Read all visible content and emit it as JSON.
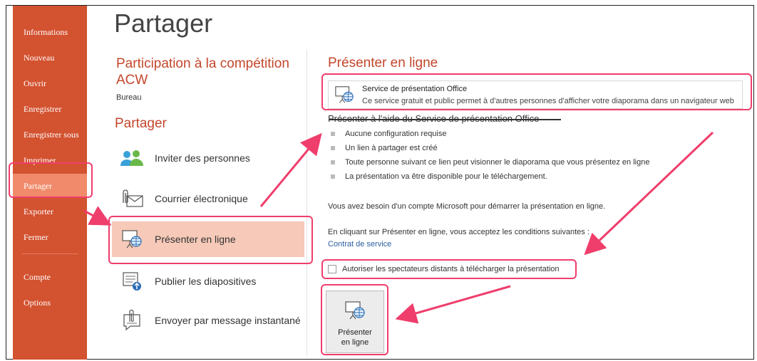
{
  "sidebar": {
    "items": [
      {
        "label": "Informations"
      },
      {
        "label": "Nouveau"
      },
      {
        "label": "Ouvrir"
      },
      {
        "label": "Enregistrer"
      },
      {
        "label": "Enregistrer sous"
      },
      {
        "label": "Imprimer"
      },
      {
        "label": "Partager",
        "selected": true
      },
      {
        "label": "Exporter"
      },
      {
        "label": "Fermer"
      },
      {
        "label": "Compte"
      },
      {
        "label": "Options"
      }
    ]
  },
  "page": {
    "title": "Partager",
    "doc_title": "Participation à la compétition ACW",
    "doc_location": "Bureau",
    "share_heading": "Partager"
  },
  "share_options": [
    {
      "label": "Inviter des personnes",
      "icon": "people-icon"
    },
    {
      "label": "Courrier électronique",
      "icon": "email-attachment-icon"
    },
    {
      "label": "Présenter en ligne",
      "icon": "present-online-icon",
      "selected": true
    },
    {
      "label": "Publier les diapositives",
      "icon": "publish-slides-icon"
    },
    {
      "label": "Envoyer par message instantané",
      "icon": "instant-message-icon"
    }
  ],
  "present_panel": {
    "heading": "Présenter en ligne",
    "service_name": "Service de présentation Office",
    "service_desc": "Ce service gratuit et public permet à d'autres personnes d'afficher votre diaporama dans un navigateur web",
    "using_heading": "Présenter à l'aide du Service de présentation Office",
    "bullets": [
      "Aucune configuration requise",
      "Un lien à partager est créé",
      "Toute personne suivant ce lien peut visionner le diaporama que vous présentez en ligne",
      "La présentation va être disponible pour le téléchargement."
    ],
    "account_note": "Vous avez besoin d'un compte Microsoft pour démarrer la présentation en ligne.",
    "terms_note": "En cliquant sur Présenter en ligne, vous acceptez les conditions suivantes :",
    "terms_link": "Contrat de service",
    "checkbox_label": "Autoriser les spectateurs distants à télécharger la présentation",
    "checkbox_checked": false,
    "button_line1": "Présenter",
    "button_line2": "en ligne"
  },
  "colors": {
    "sidebar_bg": "#d35230",
    "sidebar_selected": "#f08a6a",
    "accent_text": "#c4462b",
    "share_selected": "#f6c9b8",
    "annotation": "#ef3e6c"
  }
}
